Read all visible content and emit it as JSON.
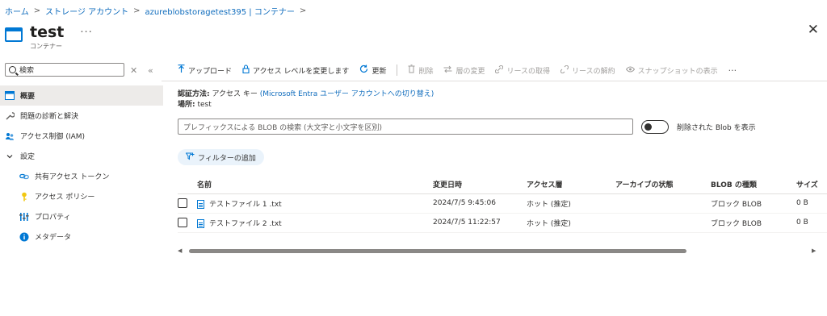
{
  "breadcrumb": {
    "home": "ホーム",
    "storage_accounts": "ストレージ アカウント",
    "account": "azureblobstoragetest395 | コンテナー",
    "sep": ">"
  },
  "header": {
    "title": "test",
    "subtitle": "コンテナー",
    "more": "···",
    "close": "✕"
  },
  "sidebar": {
    "search_placeholder": "検索",
    "clear": "✕",
    "collapse": "«",
    "items": [
      {
        "label": "概要",
        "icon": "overview-icon"
      },
      {
        "label": "問題の診断と解決",
        "icon": "wrench-icon"
      },
      {
        "label": "アクセス制御 (IAM)",
        "icon": "people-icon"
      },
      {
        "label": "設定",
        "icon": "chevron-down-icon"
      },
      {
        "label": "共有アクセス トークン",
        "icon": "link-icon"
      },
      {
        "label": "アクセス ポリシー",
        "icon": "key-icon"
      },
      {
        "label": "プロパティ",
        "icon": "properties-icon"
      },
      {
        "label": "メタデータ",
        "icon": "info-icon"
      }
    ]
  },
  "toolbar": {
    "upload": "アップロード",
    "change_access": "アクセス レベルを変更します",
    "refresh": "更新",
    "delete": "削除",
    "change_tier": "層の変更",
    "acquire_lease": "リースの取得",
    "break_lease": "リースの解約",
    "view_snapshots": "スナップショットの表示",
    "more": "···"
  },
  "auth": {
    "method_label": "認証方法:",
    "method_value": "アクセス キー",
    "switch_link": "(Microsoft Entra ユーザー アカウントへの切り替え)",
    "location_label": "場所:",
    "location_value": "test"
  },
  "filter": {
    "prefix_placeholder": "プレフィックスによる BLOB の検索 (大文字と小文字を区別)",
    "show_deleted": "削除された Blob を表示",
    "add_filter": "フィルターの追加"
  },
  "table": {
    "columns": [
      "名前",
      "変更日時",
      "アクセス層",
      "アーカイブの状態",
      "BLOB の種類",
      "サイズ"
    ],
    "rows": [
      {
        "name": "テストファイル 1 .txt",
        "modified": "2024/7/5 9:45:06",
        "tier": "ホット (推定)",
        "archive": "",
        "type": "ブロック BLOB",
        "size": "0 B"
      },
      {
        "name": "テストファイル 2 .txt",
        "modified": "2024/7/5 11:22:57",
        "tier": "ホット (推定)",
        "archive": "",
        "type": "ブロック BLOB",
        "size": "0 B"
      }
    ]
  },
  "colors": {
    "accent": "#0078d4",
    "link": "#0f6cbd",
    "disabled": "#a19f9d",
    "active_bg": "#edebe9"
  }
}
